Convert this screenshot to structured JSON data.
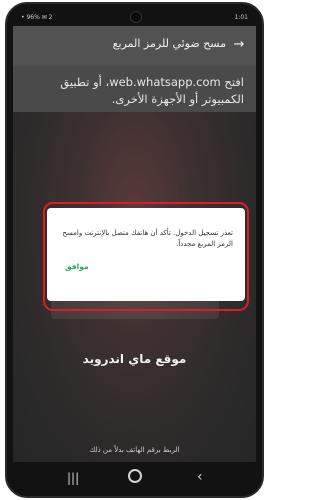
{
  "status_bar": {
    "left": "• 96% ✉ 2",
    "right": "1:01"
  },
  "app_bar": {
    "title": "مسح ضوئي للرمز المربع",
    "back_icon": "arrow-right-icon"
  },
  "instructions": "افتح web.whatsapp.com، أو تطبيق الكمبيوتر أو الأجهزة الأخرى.",
  "dialog": {
    "message": "تعذر تسجيل الدخول. تأكد أن هاتفك متصل بالإنترنت وامسح الرمز المربع مجدداً.",
    "ok_label": "موافق"
  },
  "site_title": "موقع ماي اندرويد",
  "bottom_link": "الربط برقم الهاتف بدلاً من ذلك",
  "nav": {
    "recents": "|||",
    "back": "‹"
  },
  "colors": {
    "accent": "#1fa855",
    "highlight": "#d81f26"
  }
}
